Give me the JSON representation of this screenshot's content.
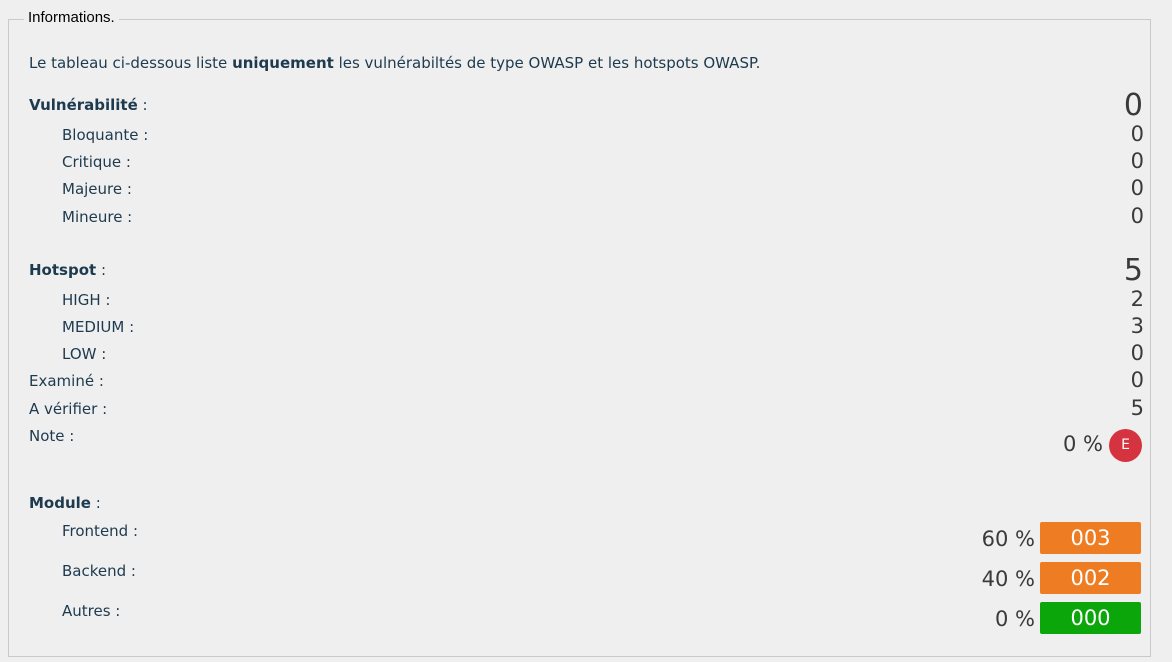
{
  "legend": "Informations.",
  "intro": {
    "before": "Le tableau ci-dessous liste ",
    "bold": "uniquement",
    "after": " les vulnérabiltés de type OWASP et les hotspots OWASP."
  },
  "vulnerability": {
    "label": "Vulnérabilité",
    "suffix": " :",
    "total": "0",
    "items": [
      {
        "label": "Bloquante :",
        "value": "0"
      },
      {
        "label": "Critique :",
        "value": "0"
      },
      {
        "label": "Majeure :",
        "value": "0"
      },
      {
        "label": "Mineure :",
        "value": "0"
      }
    ]
  },
  "hotspot": {
    "label": "Hotspot",
    "suffix": " :",
    "total": "5",
    "items": [
      {
        "label": "HIGH :",
        "value": "2"
      },
      {
        "label": "MEDIUM :",
        "value": "3"
      },
      {
        "label": "LOW :",
        "value": "0"
      }
    ],
    "examined": {
      "label": "Examiné :",
      "value": "0"
    },
    "to_verify": {
      "label": "A vérifier :",
      "value": "5"
    }
  },
  "note": {
    "label": "Note :",
    "percent": "0 %",
    "grade": "E",
    "grade_color": "#d4333f"
  },
  "module": {
    "label": "Module",
    "suffix": " :",
    "items": [
      {
        "label": "Frontend :",
        "percent": "60 %",
        "count": "003",
        "color": "#ee7c22"
      },
      {
        "label": "Backend :",
        "percent": "40 %",
        "count": "002",
        "color": "#ee7c22"
      },
      {
        "label": "Autres :",
        "percent": "0 %",
        "count": "000",
        "color": "#0aa60a"
      }
    ]
  }
}
